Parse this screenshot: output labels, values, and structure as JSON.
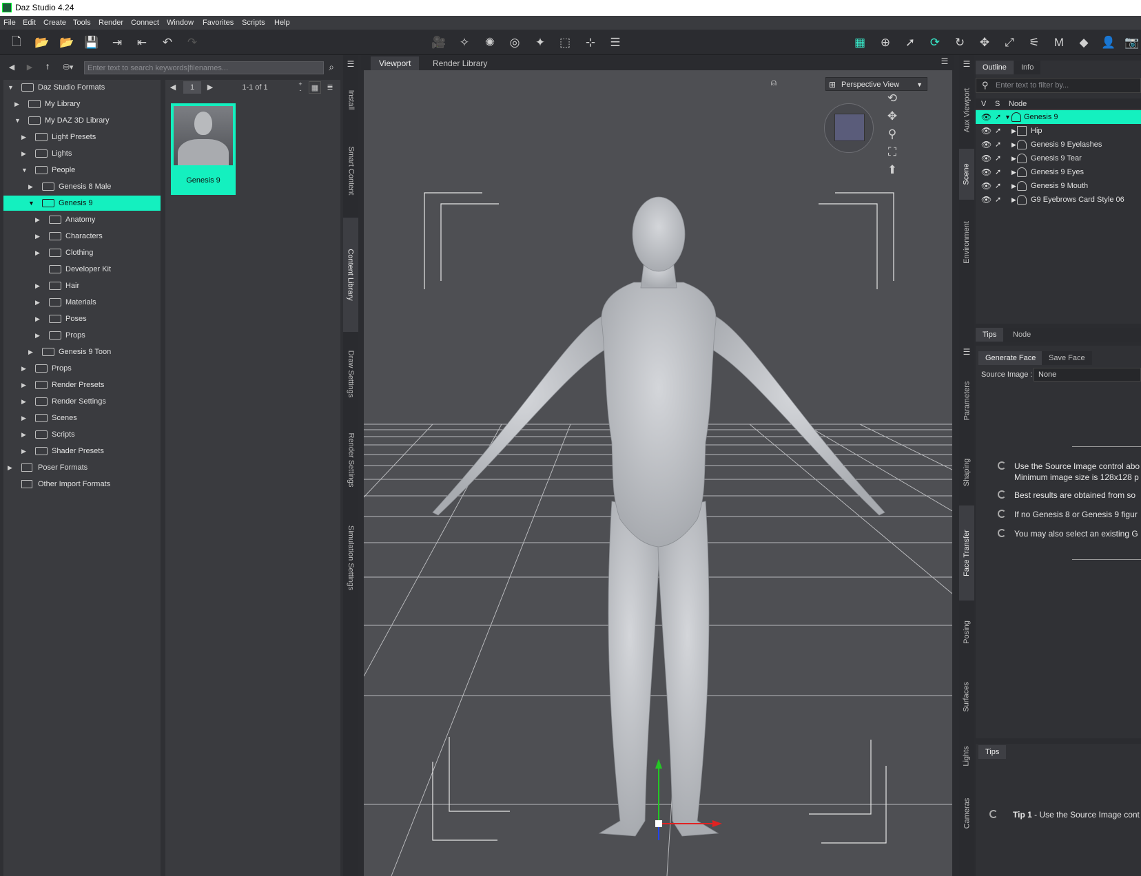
{
  "window": {
    "title": "Daz Studio 4.24"
  },
  "menu": [
    "File",
    "Edit",
    "Create",
    "Tools",
    "Render",
    "Connect",
    "Window",
    "Favorites",
    "Scripts",
    "Help"
  ],
  "accent": "#14f0bf",
  "left_side_tabs": [
    "Install",
    "Smart Content",
    "Content Library",
    "Draw Settings",
    "Render Settings",
    "Simulation Settings"
  ],
  "content_library": {
    "search_placeholder": "Enter text to search keywords|filenames...",
    "tree": [
      {
        "label": "Daz Studio Formats",
        "level": 0,
        "expanded": true
      },
      {
        "label": "My Library",
        "level": 1,
        "expanded": false
      },
      {
        "label": "My DAZ 3D Library",
        "level": 1,
        "expanded": true
      },
      {
        "label": "Light Presets",
        "level": 2,
        "expanded": false
      },
      {
        "label": "Lights",
        "level": 2,
        "expanded": false
      },
      {
        "label": "People",
        "level": 2,
        "expanded": true
      },
      {
        "label": "Genesis 8 Male",
        "level": 3,
        "expanded": false
      },
      {
        "label": "Genesis 9",
        "level": 3,
        "expanded": true,
        "selected": true
      },
      {
        "label": "Anatomy",
        "level": 4,
        "expanded": false
      },
      {
        "label": "Characters",
        "level": 4,
        "expanded": false
      },
      {
        "label": "Clothing",
        "level": 4,
        "expanded": false
      },
      {
        "label": "Developer Kit",
        "level": 4,
        "leaf": true
      },
      {
        "label": "Hair",
        "level": 4,
        "expanded": false
      },
      {
        "label": "Materials",
        "level": 4,
        "expanded": false
      },
      {
        "label": "Poses",
        "level": 4,
        "expanded": false
      },
      {
        "label": "Props",
        "level": 4,
        "expanded": false
      },
      {
        "label": "Genesis 9 Toon",
        "level": 3,
        "expanded": false
      },
      {
        "label": "Props",
        "level": 2,
        "expanded": false
      },
      {
        "label": "Render Presets",
        "level": 2,
        "expanded": false
      },
      {
        "label": "Render Settings",
        "level": 2,
        "expanded": false
      },
      {
        "label": "Scenes",
        "level": 2,
        "expanded": false
      },
      {
        "label": "Scripts",
        "level": 2,
        "expanded": false
      },
      {
        "label": "Shader Presets",
        "level": 2,
        "expanded": false
      },
      {
        "label": "Poser Formats",
        "level": 0,
        "expanded": false,
        "box": true
      },
      {
        "label": "Other Import Formats",
        "level": 0,
        "leaf": true,
        "box": true
      }
    ],
    "page": "1",
    "page_range": "1-1 of 1",
    "items": [
      {
        "label": "Genesis 9"
      }
    ]
  },
  "viewport": {
    "tabs": [
      "Viewport",
      "Render Library"
    ],
    "camera": "Perspective View"
  },
  "right_side_tabs_top": [
    "Aux Viewport",
    "Scene",
    "Environment"
  ],
  "right_side_tabs_bottom": [
    "Parameters",
    "Shaping",
    "Face Transfer",
    "Posing",
    "Surfaces",
    "Lights",
    "Cameras"
  ],
  "scene": {
    "tabs": [
      "Outline",
      "Info"
    ],
    "filter_placeholder": "Enter text to filter by...",
    "columns": [
      "V",
      "S",
      "Node"
    ],
    "nodes": [
      {
        "label": "Genesis 9",
        "selected": true,
        "expanded": true,
        "icon": "figure-icon"
      },
      {
        "label": "Hip",
        "icon": "bone-icon"
      },
      {
        "label": "Genesis 9 Eyelashes",
        "icon": "figure-icon"
      },
      {
        "label": "Genesis 9 Tear",
        "icon": "figure-icon"
      },
      {
        "label": "Genesis 9 Eyes",
        "icon": "figure-icon"
      },
      {
        "label": "Genesis 9 Mouth",
        "icon": "figure-icon"
      },
      {
        "label": "G9 Eyebrows Card Style 06",
        "icon": "figure-icon"
      }
    ],
    "bottom_tabs": [
      "Tips",
      "Node"
    ]
  },
  "face_transfer": {
    "tabs": [
      "Generate Face",
      "Save Face"
    ],
    "source_label": "Source Image :",
    "source_value": "None",
    "tips": [
      "Use the Source Image control abo",
      "Minimum image size is 128x128 p",
      "Best results are obtained from so",
      "If no Genesis 8 or Genesis 9 figur",
      "You may also select an existing G"
    ]
  },
  "tips_panel": {
    "tab": "Tips",
    "tip_bold": "Tip 1",
    "tip_text": " - Use the Source Image cont"
  }
}
